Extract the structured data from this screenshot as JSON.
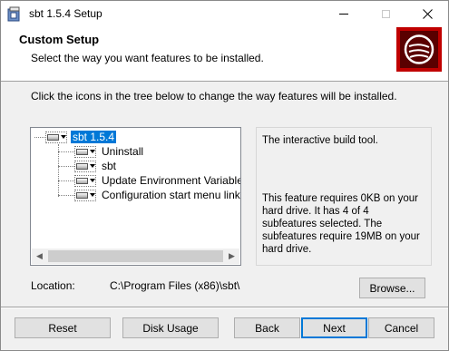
{
  "window": {
    "title": "sbt 1.5.4 Setup"
  },
  "header": {
    "title": "Custom Setup",
    "subtitle": "Select the way you want features to be installed."
  },
  "instruction": "Click the icons in the tree below to change the way features will be installed.",
  "tree": {
    "root": {
      "label": "sbt 1.5.4",
      "icon": "drive-icon",
      "selected": true
    },
    "children": [
      {
        "label": "Uninstall",
        "icon": "drive-icon"
      },
      {
        "label": "sbt",
        "icon": "drive-icon"
      },
      {
        "label": "Update Environment Variables",
        "icon": "drive-icon"
      },
      {
        "label": "Configuration start menu links",
        "icon": "drive-icon"
      }
    ]
  },
  "description": {
    "summary": "The interactive build tool.",
    "details": [
      "This feature requires 0KB on your",
      "hard drive. It has 4 of 4",
      "subfeatures selected. The",
      "subfeatures require 19MB on your",
      "hard drive."
    ]
  },
  "location": {
    "label": "Location:",
    "path": "C:\\Program Files (x86)\\sbt\\"
  },
  "buttons": {
    "browse": "Browse...",
    "reset": "Reset",
    "disk_usage": "Disk Usage",
    "back": "Back",
    "next": "Next",
    "cancel": "Cancel"
  },
  "colors": {
    "accent": "#0078d7",
    "logo_red": "#c00000"
  }
}
